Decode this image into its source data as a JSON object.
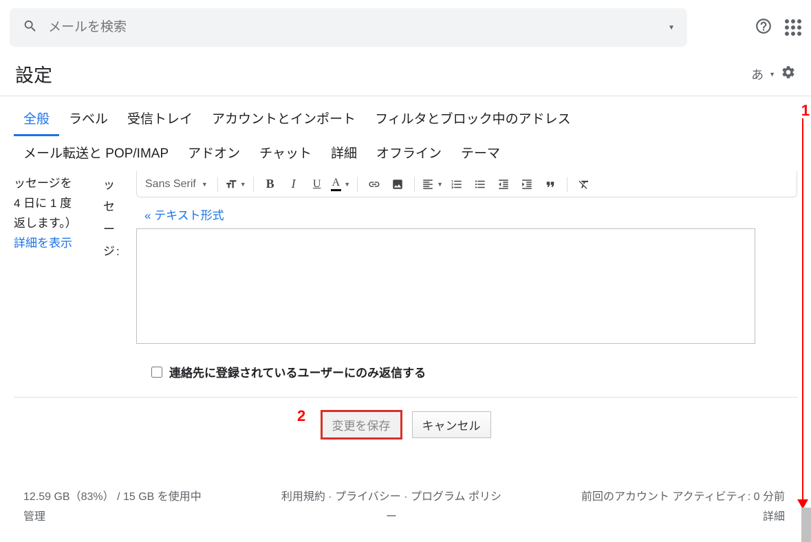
{
  "header": {
    "search_placeholder": "メールを検索"
  },
  "title_row": {
    "title": "設定",
    "lang_label": "あ"
  },
  "tabs": [
    {
      "label": "全般",
      "active": true
    },
    {
      "label": "ラベル"
    },
    {
      "label": "受信トレイ"
    },
    {
      "label": "アカウントとインポート"
    },
    {
      "label": "フィルタとブロック中のアドレス"
    },
    {
      "label": "メール転送と POP/IMAP"
    },
    {
      "label": "アドオン"
    },
    {
      "label": "チャット"
    },
    {
      "label": "詳細"
    },
    {
      "label": "オフライン"
    },
    {
      "label": "テーマ"
    }
  ],
  "left": {
    "line1": "ッセージを",
    "line2": "4 日に 1 度",
    "line3": "返します。）",
    "link": "詳細を表示"
  },
  "mid": {
    "line1": "ッ",
    "line2": "セ",
    "line3": "ー",
    "line4": "ジ:"
  },
  "toolbar": {
    "font": "Sans Serif"
  },
  "text_mode_link": "« テキスト形式",
  "checkbox_label": "連絡先に登録されているユーザーにのみ返信する",
  "buttons": {
    "save": "変更を保存",
    "cancel": "キャンセル"
  },
  "footer": {
    "left_line1": "12.59 GB（83%） / 15 GB を使用中",
    "left_line2": "管理",
    "mid_line1": "利用規約 · プライバシー · プログラム ポリシ",
    "mid_line2": "ー",
    "right_line1": "前回のアカウント アクティビティ: 0 分前",
    "right_line2": "詳細"
  },
  "annotations": {
    "n1": "1",
    "n2": "2"
  }
}
